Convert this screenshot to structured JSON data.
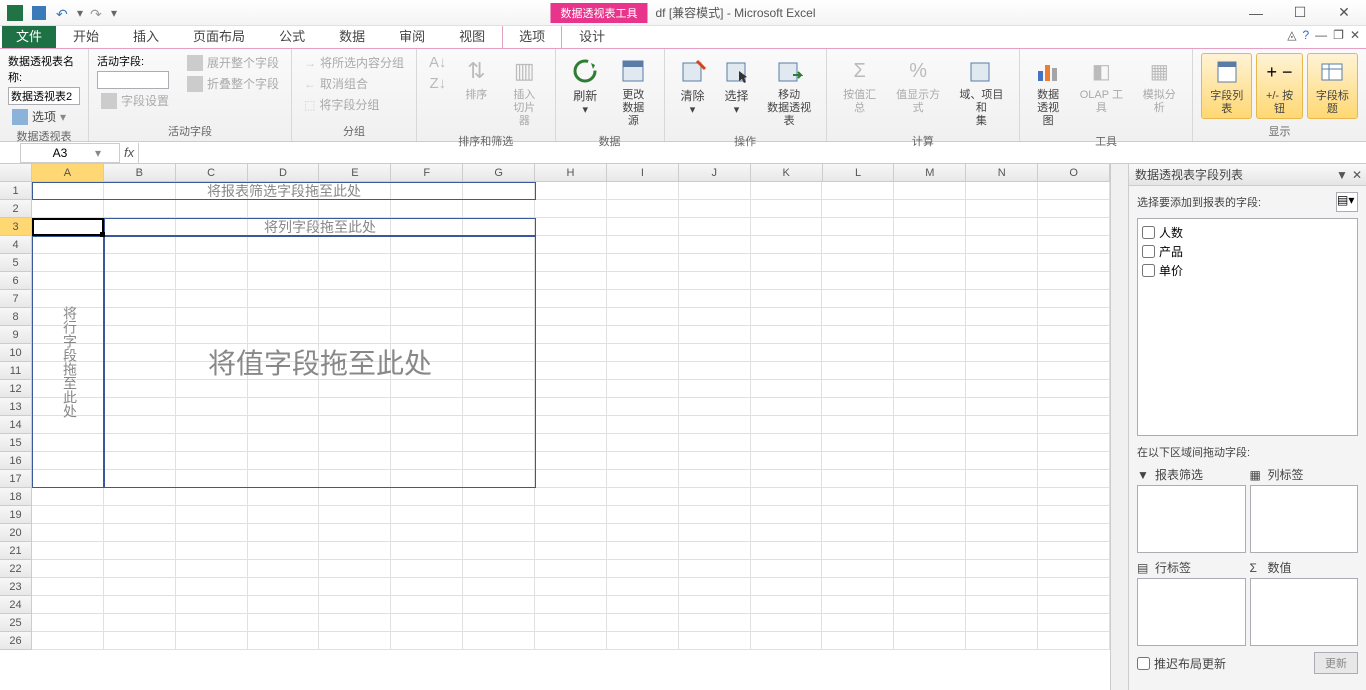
{
  "title": {
    "context_tab": "数据透视表工具",
    "doc": "df  [兼容模式]  -  Microsoft Excel"
  },
  "tabs": {
    "file": "文件",
    "home": "开始",
    "insert": "插入",
    "layout": "页面布局",
    "formulas": "公式",
    "data": "数据",
    "review": "审阅",
    "view": "视图",
    "options": "选项",
    "design": "设计"
  },
  "ribbon": {
    "pivot_name_label": "数据透视表名称:",
    "pivot_name_value": "数据透视表2",
    "options_btn": "选项",
    "group_pivot": "数据透视表",
    "active_field_label": "活动字段:",
    "active_field_value": "",
    "field_settings": "字段设置",
    "expand_field": "展开整个字段",
    "collapse_field": "折叠整个字段",
    "group_activefield": "活动字段",
    "group_selection": "将所选内容分组",
    "ungroup": "取消组合",
    "group_field": "将字段分组",
    "group_group": "分组",
    "sort": "排序",
    "slicer": "插入\n切片器",
    "group_sortfilter": "排序和筛选",
    "refresh": "刷新",
    "change_source": "更改\n数据源",
    "group_data": "数据",
    "clear": "清除",
    "select": "选择",
    "move_pivot": "移动\n数据透视表",
    "group_actions": "操作",
    "summarize_by": "按值汇总",
    "show_values_as": "值显示方式",
    "fields_items": "域、项目和\n集",
    "group_calc": "计算",
    "pivot_chart": "数据\n透视图",
    "olap": "OLAP 工具",
    "whatif": "模拟分析",
    "group_tools": "工具",
    "field_list": "字段列表",
    "pm_buttons": "+/- 按钮",
    "field_headers": "字段标题",
    "group_show": "显示"
  },
  "namebox": "A3",
  "columns": [
    "A",
    "B",
    "C",
    "D",
    "E",
    "F",
    "G",
    "H",
    "I",
    "J",
    "K",
    "L",
    "M",
    "N",
    "O"
  ],
  "rows": [
    "1",
    "2",
    "3",
    "4",
    "5",
    "6",
    "7",
    "8",
    "9",
    "10",
    "11",
    "12",
    "13",
    "14",
    "15",
    "16",
    "17",
    "18",
    "19",
    "20",
    "21",
    "22",
    "23",
    "24",
    "25",
    "26"
  ],
  "pivot_placeholders": {
    "filter": "将报表筛选字段拖至此处",
    "cols": "将列字段拖至此处",
    "rows": "将行字段拖至此处",
    "vals": "将值字段拖至此处"
  },
  "field_pane": {
    "title": "数据透视表字段列表",
    "choose_label": "选择要添加到报表的字段:",
    "fields": [
      "人数",
      "产品",
      "单价"
    ],
    "areas_label": "在以下区域间拖动字段:",
    "area_filter": "报表筛选",
    "area_cols": "列标签",
    "area_rows": "行标签",
    "area_vals": "数值",
    "defer": "推迟布局更新",
    "update": "更新"
  }
}
